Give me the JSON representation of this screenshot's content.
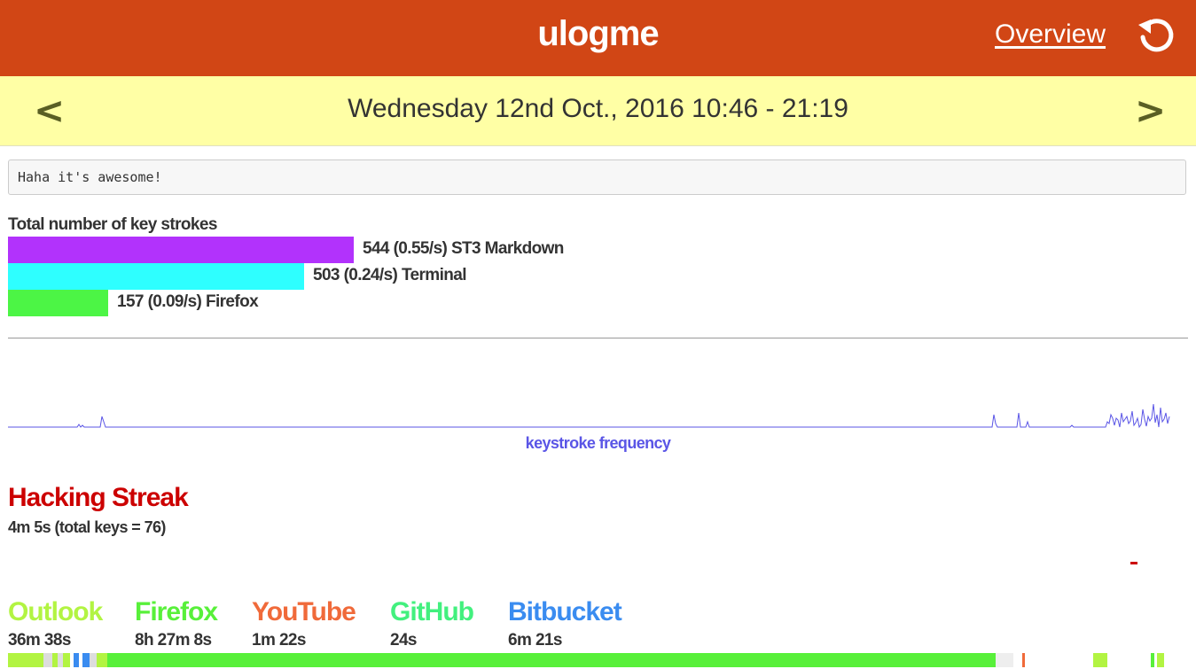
{
  "header": {
    "title": "ulogme",
    "overview_link": "Overview",
    "refresh_icon": "refresh-icon",
    "background_color": "#d14615"
  },
  "date_nav": {
    "prev_label": "<",
    "next_label": ">",
    "date_text": "Wednesday 12nd Oct., 2016 10:46 - 21:19",
    "background_color": "#ffffa5"
  },
  "note": {
    "value": "Haha it's awesome!"
  },
  "keystrokes": {
    "title": "Total number of key strokes",
    "rows": [
      {
        "label": "544 (0.55/s) ST3 Markdown",
        "count": 544,
        "color": "#b232fc"
      },
      {
        "label": "503 (0.24/s) Terminal",
        "count": 503,
        "color": "#2effff"
      },
      {
        "label": "157 (0.09/s) Firefox",
        "count": 157,
        "color": "#4cf545"
      }
    ]
  },
  "frequency": {
    "caption": "keystroke frequency",
    "line_color": "#5a55e6"
  },
  "streak": {
    "title": "Hacking Streak",
    "subtitle": "4m 5s (total keys = 76)",
    "color": "#cc0000"
  },
  "categories": [
    {
      "name": "Outlook",
      "time": "36m 38s",
      "color": "#b2f442"
    },
    {
      "name": "Firefox",
      "time": "8h 27m 8s",
      "color": "#58f03a"
    },
    {
      "name": "YouTube",
      "time": "1m 22s",
      "color": "#f06a3a"
    },
    {
      "name": "GitHub",
      "time": "24s",
      "color": "#42f07e"
    },
    {
      "name": "Bitbucket",
      "time": "6m 21s",
      "color": "#3a8cf0"
    }
  ]
}
